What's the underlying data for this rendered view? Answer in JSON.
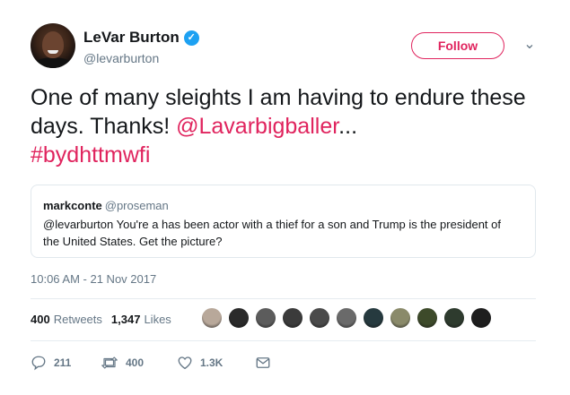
{
  "author": {
    "display_name": "LeVar Burton",
    "verified_glyph": "✓",
    "handle": "@levarburton"
  },
  "follow_label": "Follow",
  "caret_glyph": "⌄",
  "tweet": {
    "text_part1": "One of many sleights I am having to endure these days. Thanks! ",
    "mention": "@Lavarbigballer",
    "ellipsis": "...",
    "hashtag": "#bydhttmwfi"
  },
  "quoted_tweet": {
    "name": "markconte",
    "handle": "@proseman",
    "text": "@levarburton You're a has been actor with a thief for a son and Trump is the president of the United States.  Get the picture?"
  },
  "timestamp": "10:06 AM - 21 Nov 2017",
  "stats": {
    "retweets_count": "400",
    "retweets_label": "Retweets",
    "likes_count": "1,347",
    "likes_label": "Likes"
  },
  "liker_avatar_colors": [
    "#b8a89a",
    "#2a2a2a",
    "#5c5c5c",
    "#3b3b3b",
    "#4a4a4a",
    "#6a6a6a",
    "#263a3f",
    "#8a8a6a",
    "#3d4a2a",
    "#2e3b2e",
    "#1e1e1e"
  ],
  "actions": {
    "reply_count": "211",
    "retweet_count": "400",
    "like_count": "1.3K"
  },
  "colors": {
    "accent": "#e0245e",
    "verified": "#1da1f2",
    "muted": "#657786"
  }
}
